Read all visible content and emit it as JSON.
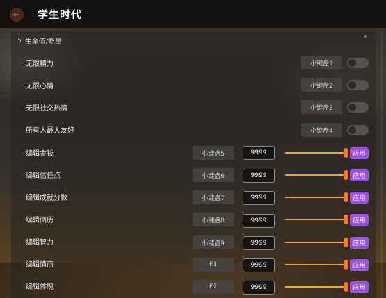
{
  "header": {
    "back_icon": "arrow-left-icon",
    "title": "学生时代"
  },
  "section": {
    "icon": "bolt-icon",
    "title": "生命值/能量",
    "collapse_icon": "chevron-up-icon"
  },
  "toggle_rows": [
    {
      "label": "无限精力",
      "hotkey": "小键盘1",
      "on": false
    },
    {
      "label": "无限心情",
      "hotkey": "小键盘2",
      "on": false
    },
    {
      "label": "无限社交热情",
      "hotkey": "小键盘3",
      "on": false
    },
    {
      "label": "所有人最大友好",
      "hotkey": "小键盘4",
      "on": false
    }
  ],
  "edit_rows": [
    {
      "label": "编辑金钱",
      "hotkey": "小键盘5",
      "value": "9999",
      "slider_fraction": 1.0,
      "apply": "应用"
    },
    {
      "label": "编辑信任点",
      "hotkey": "小键盘6",
      "value": "9999",
      "slider_fraction": 1.0,
      "apply": "应用"
    },
    {
      "label": "编辑成就分数",
      "hotkey": "小键盘7",
      "value": "9999",
      "slider_fraction": 1.0,
      "apply": "应用"
    },
    {
      "label": "编辑阅历",
      "hotkey": "小键盘8",
      "value": "9999",
      "slider_fraction": 1.0,
      "apply": "应用"
    },
    {
      "label": "编辑智力",
      "hotkey": "小键盘9",
      "value": "9999",
      "slider_fraction": 1.0,
      "apply": "应用"
    },
    {
      "label": "编辑情商",
      "hotkey": "F1",
      "value": "9999",
      "slider_fraction": 1.0,
      "apply": "应用"
    },
    {
      "label": "编辑体魄",
      "hotkey": "F2",
      "value": "9999",
      "slider_fraction": 1.0,
      "apply": "应用"
    }
  ],
  "colors": {
    "accent_orange": "#f47a2a",
    "apply_purple": "#9c4fe8"
  }
}
